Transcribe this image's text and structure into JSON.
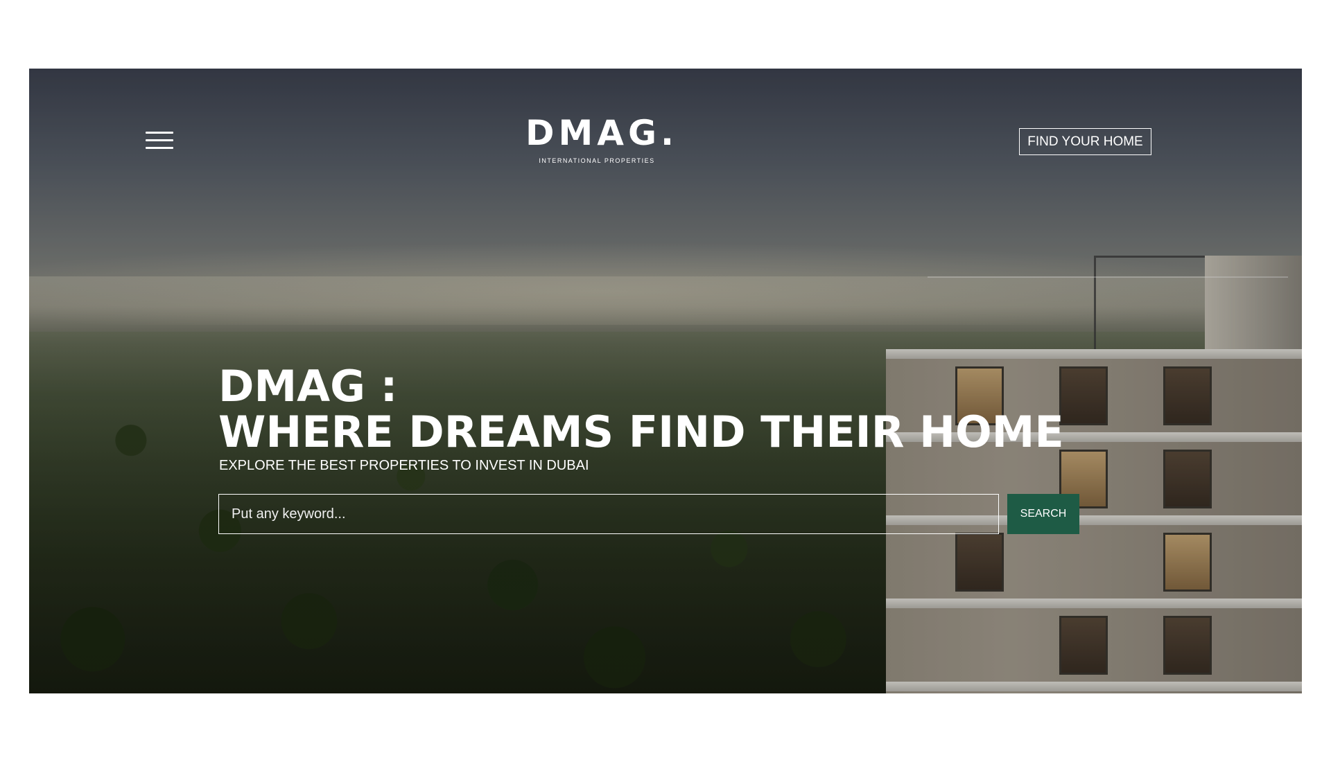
{
  "header": {
    "logo_text": "DMAG.",
    "logo_subtitle": "INTERNATIONAL PROPERTIES",
    "find_home_label": "FIND YOUR HOME"
  },
  "hero": {
    "headline_line1": "DMAG :",
    "headline_line2": "WHERE DREAMS FIND THEIR HOME",
    "subheadline": "EXPLORE THE BEST PROPERTIES TO INVEST IN DUBAI"
  },
  "search": {
    "placeholder": "Put any keyword...",
    "button_label": "SEARCH"
  },
  "icons": {
    "menu": "hamburger-menu-icon",
    "whatsapp": "whatsapp-icon"
  },
  "colors": {
    "search_button": "#1e5b45",
    "whatsapp": "#1fb84e"
  }
}
